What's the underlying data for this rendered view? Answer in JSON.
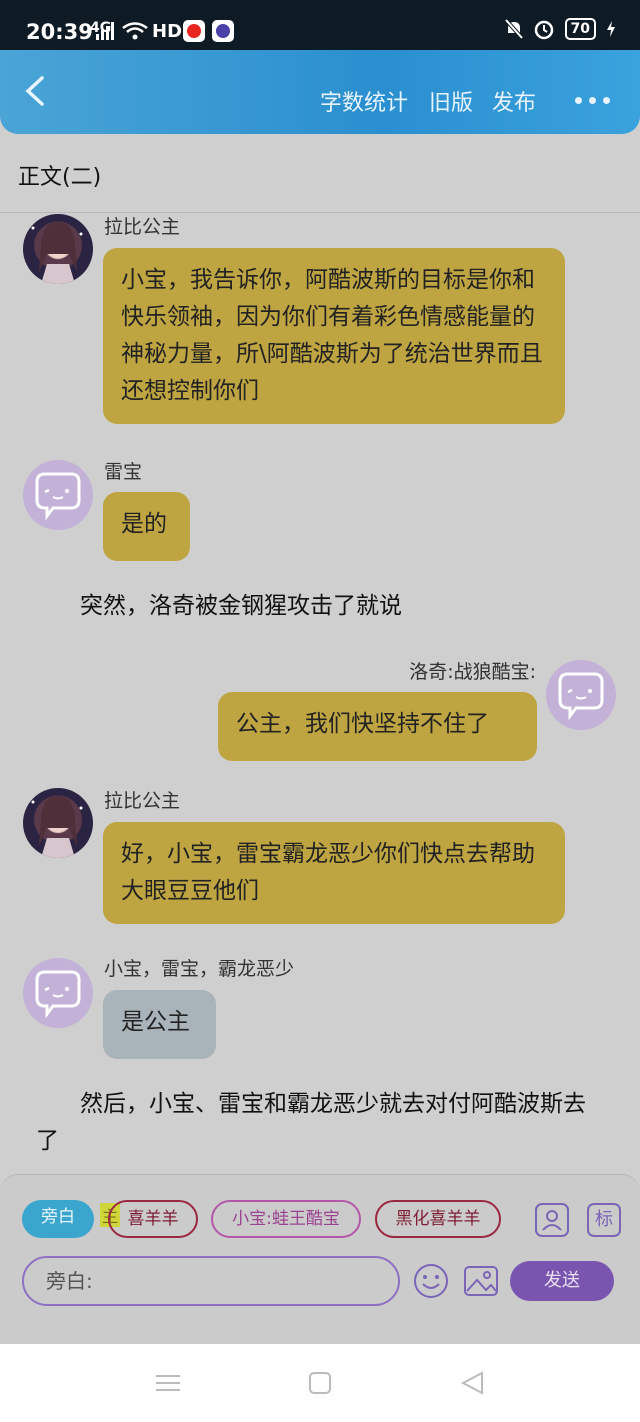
{
  "status": {
    "time": "20:39",
    "network": "4G",
    "hd": "HD",
    "battery": "70"
  },
  "header": {
    "word_count": "字数统计",
    "old_version": "旧版",
    "publish": "发布"
  },
  "page_title": "正文(二)",
  "messages": [
    {
      "sender": "拉比公主",
      "text": "小宝，我告诉你，阿酷波斯的目标是你和快乐领袖，因为你们有着彩色情感能量的神秘力量，所\\阿酷波斯为了统治世界而且还想控制你们"
    },
    {
      "sender": "雷宝",
      "text": "是的"
    },
    {
      "narration": "突然，洛奇被金钢猩攻击了就说"
    },
    {
      "sender": "洛奇:战狼酷宝:",
      "text": "公主，我们快坚持不住了"
    },
    {
      "sender": "拉比公主",
      "text": "好，小宝，雷宝霸龙恶少你们快点去帮助大眼豆豆他们"
    },
    {
      "sender": "小宝，雷宝，霸龙恶少",
      "text": "是公主"
    },
    {
      "narration": "然后，小宝、雷宝和霸龙恶少就去对付阿酷波斯去了"
    }
  ],
  "composer": {
    "chips": [
      "旁白",
      "喜羊羊",
      "小宝:蛙王酷宝",
      "黑化喜羊羊"
    ],
    "zhu_tag": "主",
    "tag_button": "标",
    "placeholder": "旁白:",
    "send": "发送"
  },
  "colors": {
    "header": "#2a8fd0",
    "bubble": "#bfa541",
    "bubble_grey": "#a9b3ba",
    "send": "#7a55b0",
    "narrator_chip": "#3aa5cd"
  }
}
